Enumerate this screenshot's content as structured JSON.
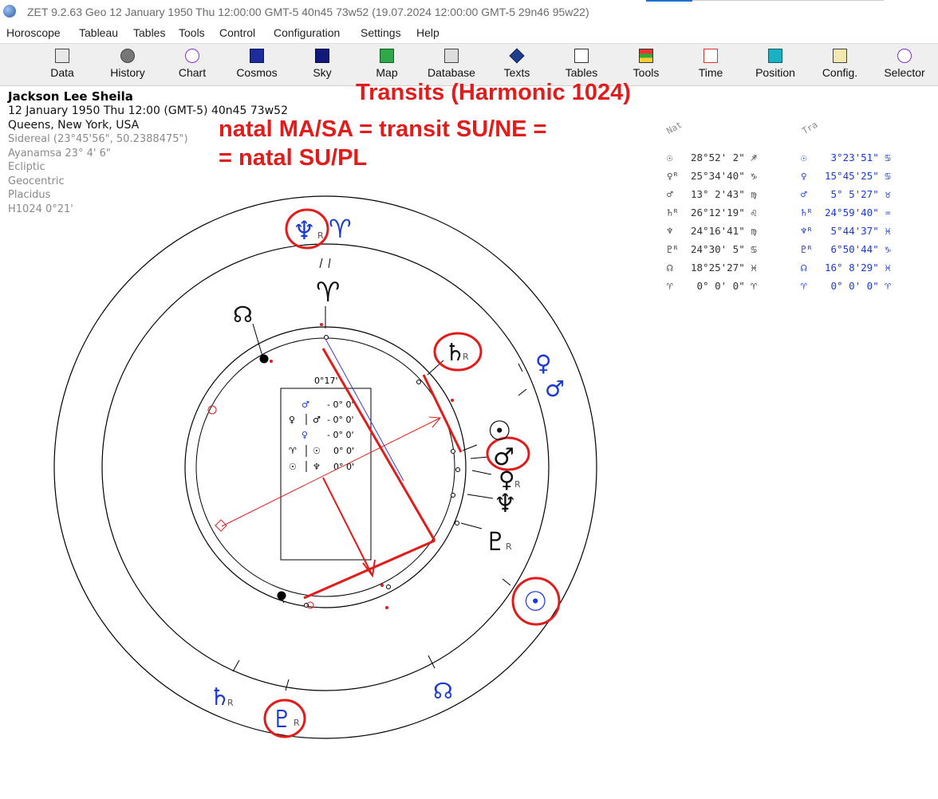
{
  "window": {
    "title": "ZET 9.2.63 Geo    12 January 1950  Thu  12:00:00 GMT-5 40n45  73w52  (19.07.2024  12:00:00 GMT-5 29n46 95w22)"
  },
  "menu": [
    "Horoscope",
    "Tableau",
    "Tables",
    "Tools",
    "Control",
    "Configuration",
    "Settings",
    "Help"
  ],
  "toolbar": [
    {
      "label": "Data",
      "icon": "data-icon"
    },
    {
      "label": "History",
      "icon": "history-icon"
    },
    {
      "label": "Chart",
      "icon": "chart-icon"
    },
    {
      "label": "Cosmos",
      "icon": "cosmos-icon"
    },
    {
      "label": "Sky",
      "icon": "sky-icon"
    },
    {
      "label": "Map",
      "icon": "map-icon"
    },
    {
      "label": "Database",
      "icon": "database-icon"
    },
    {
      "label": "Texts",
      "icon": "texts-icon"
    },
    {
      "label": "Tables",
      "icon": "tables-icon"
    },
    {
      "label": "Tools",
      "icon": "tools-icon"
    },
    {
      "label": "Time",
      "icon": "time-icon"
    },
    {
      "label": "Position",
      "icon": "position-icon"
    },
    {
      "label": "Config.",
      "icon": "config-icon"
    },
    {
      "label": "Selector",
      "icon": "selector-icon"
    }
  ],
  "info": {
    "name": "Jackson Lee Sheila",
    "datetime": "12 January 1950  Thu  12:00 (GMT-5) 40n45  73w52",
    "place": "Queens, New York, USA",
    "sidereal": "Sidereal (23°45'56\", 50.2388475\")",
    "ayanamsa": "Ayanamsa 23° 4' 6\"",
    "coords": "Ecliptic",
    "geo": "Geocentric",
    "houses": "Placidus",
    "harmonic": "H1024   0°21'"
  },
  "annotation": {
    "title": "Transits (Harmonic 1024)",
    "line1": "natal MA/SA = transit SU/NE =",
    "line2": "= natal SU/PL"
  },
  "colors": {
    "natal": "#111111",
    "transit": "#1a3ad8",
    "annotation": "#e21b1b",
    "aspect": "#e21b1b"
  },
  "chart": {
    "orb_label": "0°17'",
    "midpoint_box": [
      {
        "left": "",
        "right": "♂",
        "value": "- 0° 0'"
      },
      {
        "left": "♀",
        "right": "♂",
        "value": "- 0° 0'"
      },
      {
        "left": "",
        "right": "♀",
        "value": "- 0° 0'"
      },
      {
        "left": "♈",
        "right": "☉",
        "value": "0° 0'"
      },
      {
        "left": "☉",
        "right": "♆",
        "value": "0° 0'"
      }
    ],
    "natal_glyphs": [
      {
        "name": "natal-aries-icon",
        "glyph": "♈",
        "retro": ""
      },
      {
        "name": "natal-node-icon",
        "glyph": "☊",
        "retro": ""
      },
      {
        "name": "natal-saturn-icon",
        "glyph": "♄",
        "retro": "R"
      },
      {
        "name": "natal-sun-icon",
        "glyph": "☉",
        "retro": ""
      },
      {
        "name": "natal-venus-icon",
        "glyph": "♀",
        "retro": "R"
      },
      {
        "name": "natal-neptune-icon",
        "glyph": "♆",
        "retro": ""
      },
      {
        "name": "natal-pluto-icon",
        "glyph": "♇",
        "retro": "R"
      }
    ],
    "transit_glyphs": [
      {
        "name": "transit-neptune-icon",
        "glyph": "♆",
        "retro": "R"
      },
      {
        "name": "transit-aries-icon",
        "glyph": "♈",
        "retro": ""
      },
      {
        "name": "transit-venus-icon",
        "glyph": "♀",
        "retro": ""
      },
      {
        "name": "transit-mars-icon",
        "glyph": "♂",
        "retro": ""
      },
      {
        "name": "transit-mars-inner-icon",
        "glyph": "♂",
        "retro": ""
      },
      {
        "name": "transit-sun-icon",
        "glyph": "☉",
        "retro": ""
      },
      {
        "name": "transit-node-icon",
        "glyph": "☊",
        "retro": ""
      },
      {
        "name": "transit-saturn-icon",
        "glyph": "♄",
        "retro": "R"
      },
      {
        "name": "transit-pluto-icon",
        "glyph": "♇",
        "retro": "R"
      }
    ]
  },
  "positions": {
    "nat_header": "Nat",
    "tra_header": "Tra",
    "rows": [
      {
        "nat_sym": "☉",
        "nat_val": "28°52' 2\" ♐",
        "tra_sym": "☉",
        "tra_val": " 3°23'51\" ♋"
      },
      {
        "nat_sym": "♀ᴿ",
        "nat_val": "25°34'40\" ♑",
        "tra_sym": "♀",
        "tra_val": "15°45'25\" ♋"
      },
      {
        "nat_sym": "♂",
        "nat_val": "13° 2'43\" ♍",
        "tra_sym": "♂",
        "tra_val": " 5° 5'27\" ♉"
      },
      {
        "nat_sym": "♄ᴿ",
        "nat_val": "26°12'19\" ♌",
        "tra_sym": "♄ᴿ",
        "tra_val": "24°59'40\" ♒"
      },
      {
        "nat_sym": "♆",
        "nat_val": "24°16'41\" ♍",
        "tra_sym": "♆ᴿ",
        "tra_val": " 5°44'37\" ♓"
      },
      {
        "nat_sym": "♇ᴿ",
        "nat_val": "24°30' 5\" ♋",
        "tra_sym": "♇ᴿ",
        "tra_val": " 6°50'44\" ♑"
      },
      {
        "nat_sym": "☊",
        "nat_val": "18°25'27\" ♓",
        "tra_sym": "☊",
        "tra_val": "16° 8'29\" ♓"
      },
      {
        "nat_sym": "♈",
        "nat_val": " 0° 0' 0\" ♈",
        "tra_sym": "♈",
        "tra_val": " 0° 0' 0\" ♈"
      }
    ]
  }
}
